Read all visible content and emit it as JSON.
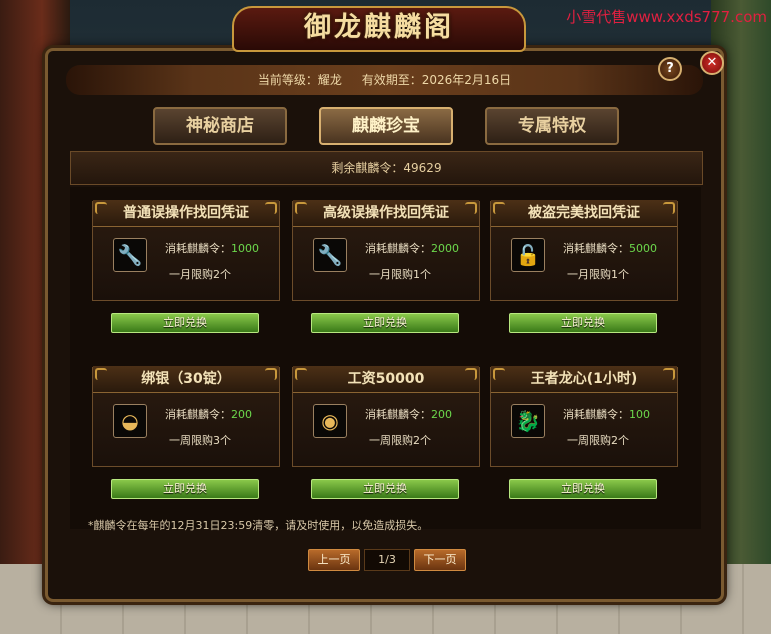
{
  "watermark": "小雪代售www.xxds777.com",
  "title": "御龙麒麟阁",
  "header": {
    "level_label": "当前等级：耀龙",
    "valid_until": "有效期至：2026年2月16日",
    "help": "?",
    "close": "✕"
  },
  "tabs": [
    {
      "label": "神秘商店",
      "active": false
    },
    {
      "label": "麒麟珍宝",
      "active": true
    },
    {
      "label": "专属特权",
      "active": false
    }
  ],
  "balance": "剩余麒麟令：49629",
  "cost_prefix": "消耗麒麟令：",
  "redeem_label": "立即兑换",
  "items": [
    {
      "name": "普通误操作找回凭证",
      "icon": "wrench-icon",
      "glyph": "🔧",
      "cost": "1000",
      "limit": "一月限购2个"
    },
    {
      "name": "高级误操作找回凭证",
      "icon": "wrench-icon",
      "glyph": "🔧",
      "cost": "2000",
      "limit": "一月限购1个"
    },
    {
      "name": "被盗完美找回凭证",
      "icon": "lock-icon",
      "glyph": "🔓",
      "cost": "5000",
      "limit": "一月限购1个"
    },
    {
      "name": "绑银（30锭）",
      "icon": "silver-ingot-icon",
      "glyph": "◒",
      "cost": "200",
      "limit": "一周限购3个"
    },
    {
      "name": "工资50000",
      "icon": "gold-ingot-icon",
      "glyph": "◉",
      "cost": "200",
      "limit": "一周限购2个"
    },
    {
      "name": "王者龙心(1小时)",
      "icon": "dragon-head-icon",
      "glyph": "🐉",
      "cost": "100",
      "limit": "一周限购2个"
    }
  ],
  "note": "*麒麟令在每年的12月31日23:59清零，请及时使用，以免造成损失。",
  "pager": {
    "prev": "上一页",
    "page": "1/3",
    "next": "下一页"
  },
  "colors": {
    "accent_gold": "#c8983c",
    "cost_green": "#6cd84c",
    "redeem_green": "#5a9a28",
    "close_red": "#d0302a"
  }
}
